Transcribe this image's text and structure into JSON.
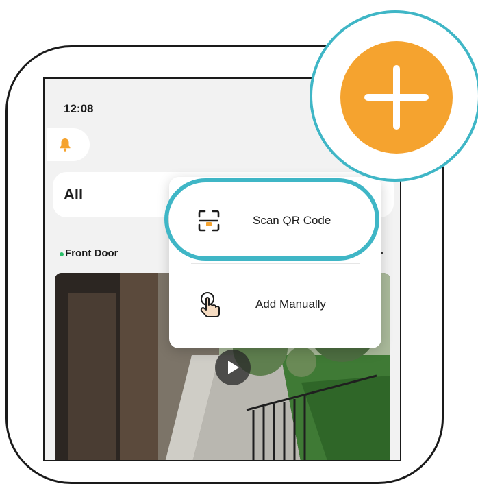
{
  "status_bar": {
    "time": "12:08"
  },
  "filter": {
    "label": "All"
  },
  "camera": {
    "name": "Front Door",
    "status_color": "#2bbf6a"
  },
  "add_menu": {
    "items": [
      {
        "label": "Scan QR Code",
        "icon": "qr-scan-icon"
      },
      {
        "label": "Add Manually",
        "icon": "tap-hand-icon"
      }
    ]
  },
  "colors": {
    "accent_orange": "#f5a32f",
    "highlight_teal": "#3fb6c6",
    "notification_bell": "#f5a32f"
  }
}
